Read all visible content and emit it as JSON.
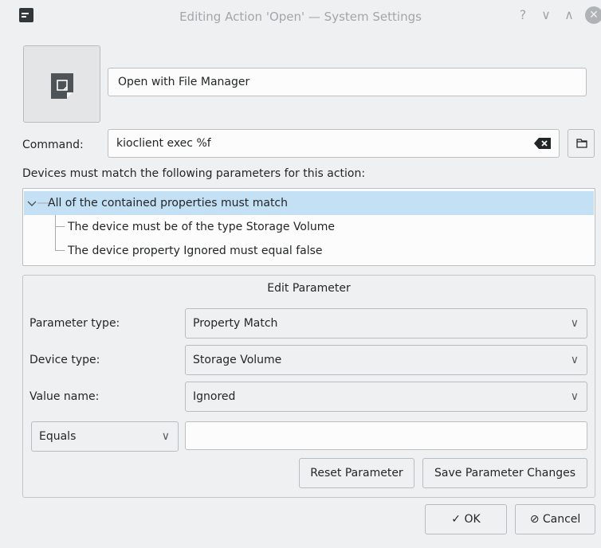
{
  "window": {
    "title": "Editing Action 'Open' — System Settings"
  },
  "titlebar_buttons": {
    "help": "?",
    "minimize": "∨",
    "maximize": "∧",
    "close": "✕"
  },
  "action": {
    "name": "Open with File Manager"
  },
  "command": {
    "label": "Command:",
    "value": "kioclient exec %f"
  },
  "devices": {
    "label": "Devices must match the following parameters for this action:",
    "tree": [
      "All of the contained properties must match",
      "The device must be of the type Storage Volume",
      "The device property Ignored must equal false"
    ]
  },
  "edit_parameter": {
    "title": "Edit Parameter",
    "parameter_type": {
      "label": "Parameter type:",
      "value": "Property Match"
    },
    "device_type": {
      "label": "Device type:",
      "value": "Storage Volume"
    },
    "value_name": {
      "label": "Value name:",
      "value": "Ignored"
    },
    "comparison": {
      "value": "Equals"
    },
    "value_field": "",
    "reset_button": "Reset Parameter",
    "save_button": "Save Parameter Changes"
  },
  "dialog_buttons": {
    "ok": "OK",
    "cancel": "Cancel"
  },
  "colors": {
    "selection": "#c4e0f5",
    "window_bg": "#eff0f1",
    "field_bg": "#fcfcfc"
  }
}
